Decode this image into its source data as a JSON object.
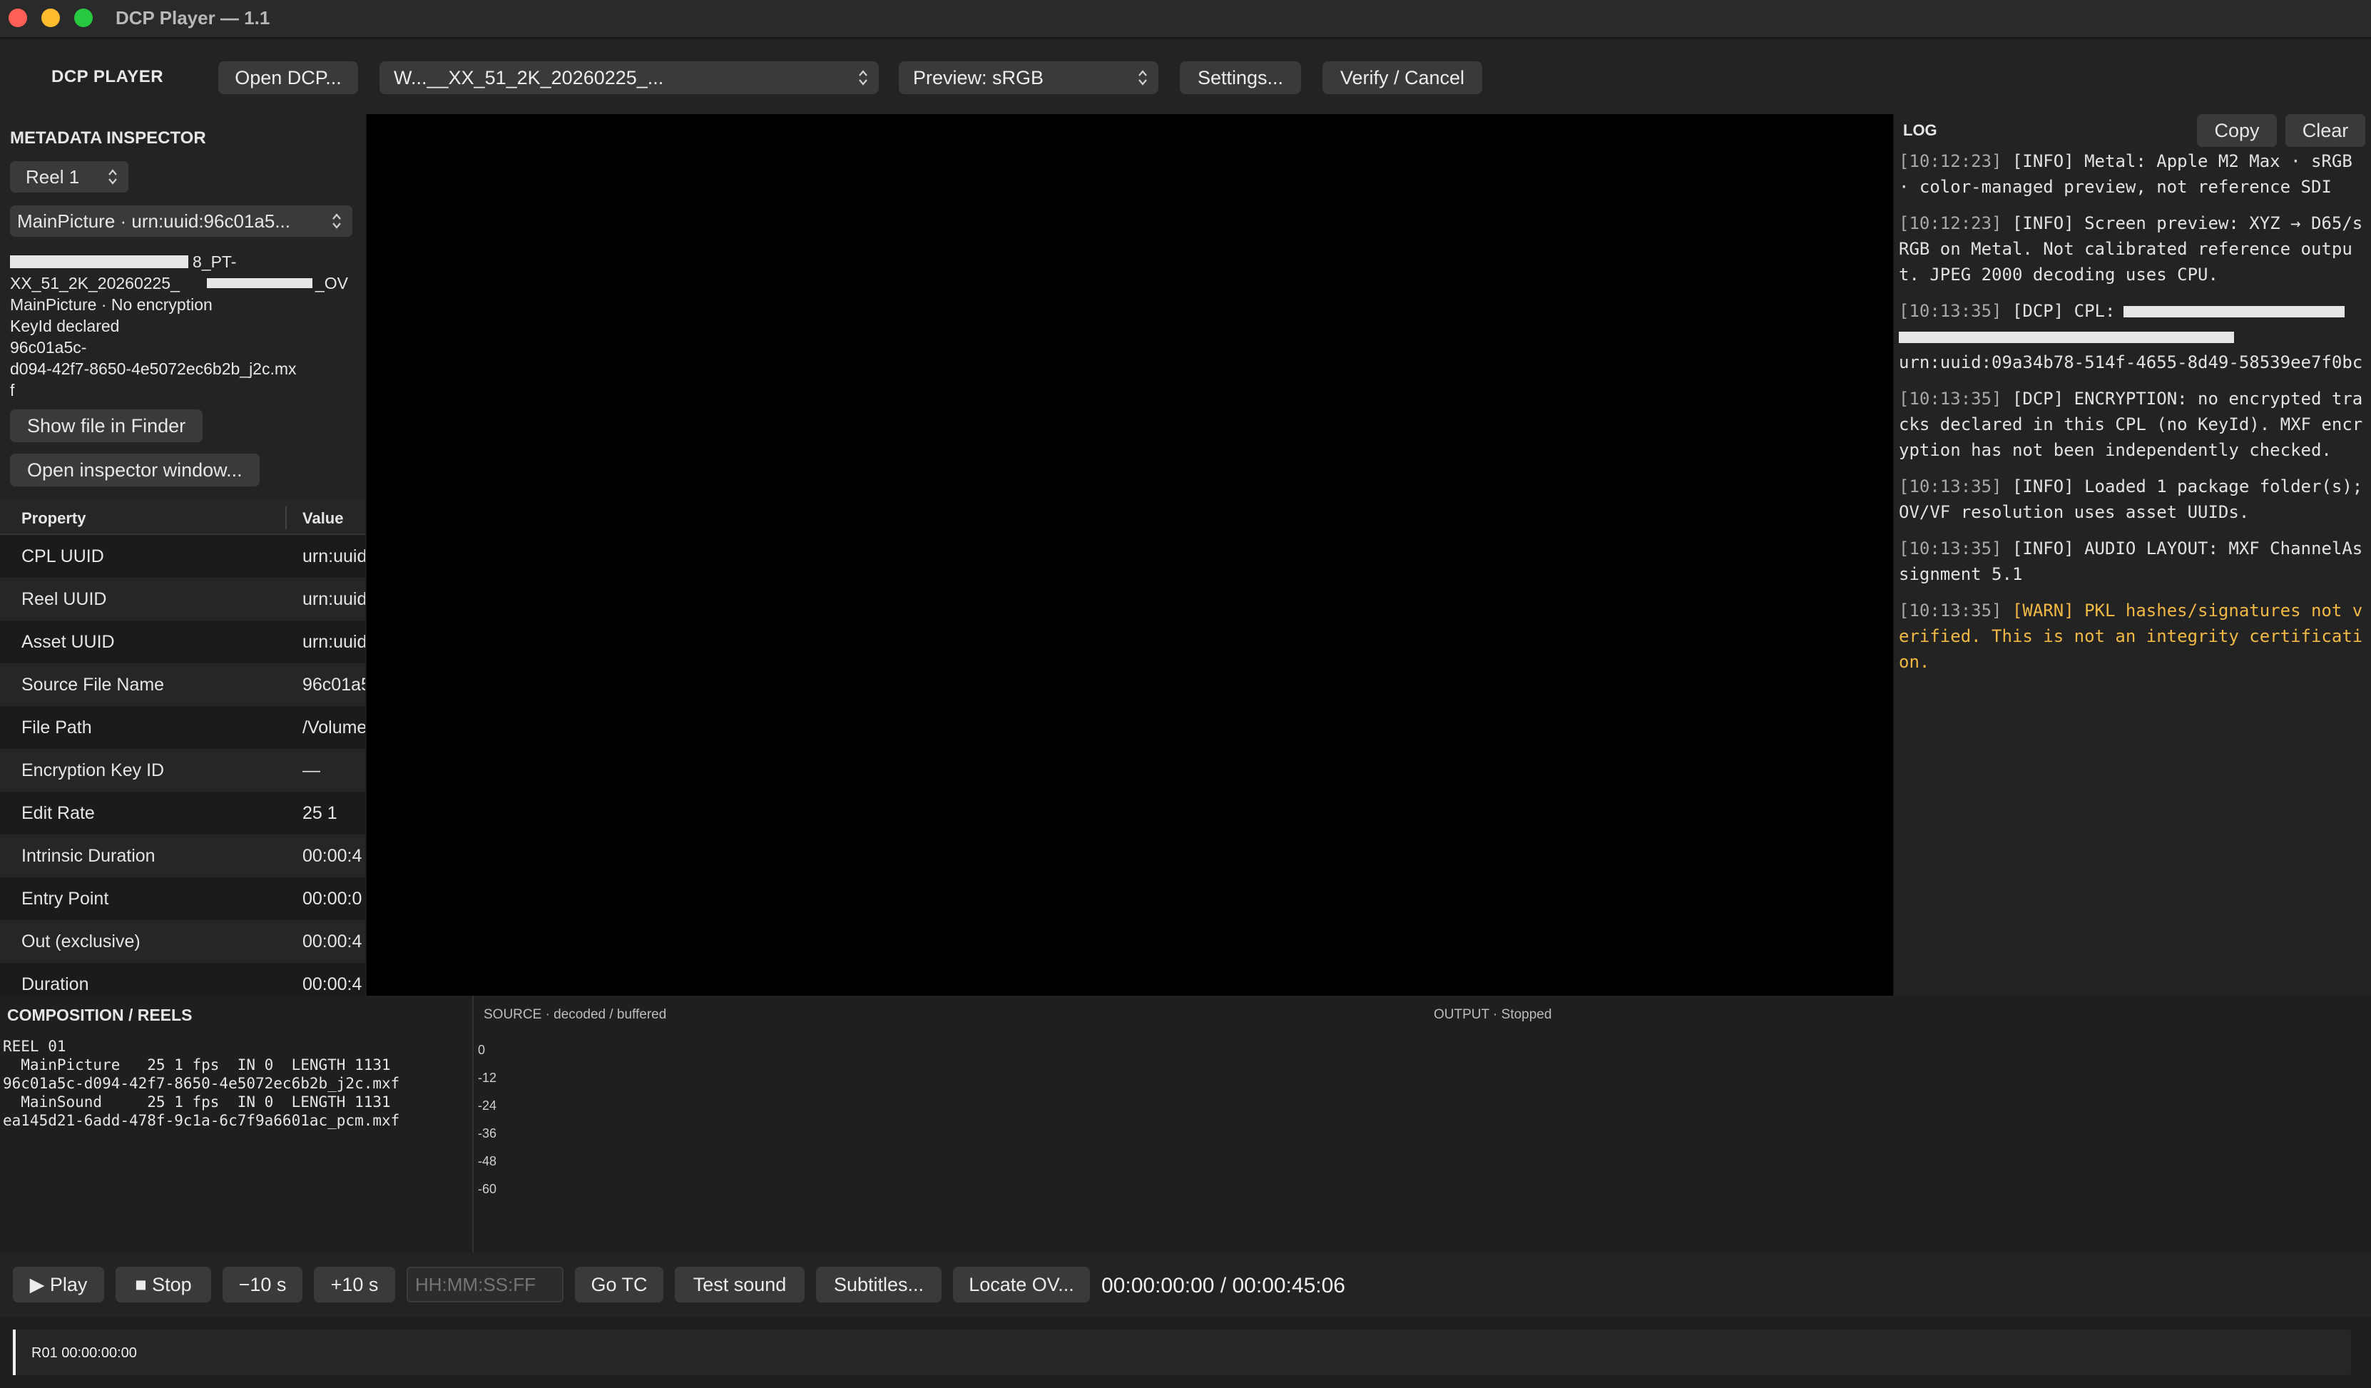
{
  "window": {
    "title": "DCP Player — 1.1"
  },
  "toolbar": {
    "brand": "DCP PLAYER",
    "open_dcp": "Open DCP...",
    "cpl_select": "W...__XX_51_2K_20260225_...",
    "preview_select": "Preview: sRGB",
    "settings": "Settings...",
    "verify_cancel": "Verify / Cancel"
  },
  "inspector": {
    "title": "METADATA INSPECTOR",
    "reel_select": "Reel 1",
    "asset_select": "MainPicture · urn:uuid:96c01a5...",
    "info_line1": "8_PT-",
    "info_line2": "XX_51_2K_20260225_",
    "info_line2_tail": "_OV",
    "info_line3": "MainPicture · No encryption",
    "info_line4": "KeyId declared",
    "info_line5": "96c01a5c-",
    "info_line6": "d094-42f7-8650-4e5072ec6b2b_j2c.mx",
    "info_line7": "f",
    "show_in_finder": "Show file in Finder",
    "open_inspector": "Open inspector window...",
    "table_headers": {
      "property": "Property",
      "value": "Value"
    },
    "rows": [
      {
        "k": "CPL UUID",
        "v": "urn:uuid"
      },
      {
        "k": "Reel UUID",
        "v": "urn:uuid"
      },
      {
        "k": "Asset UUID",
        "v": "urn:uuid"
      },
      {
        "k": "Source File Name",
        "v": "96c01a5"
      },
      {
        "k": "File Path",
        "v": "/Volume"
      },
      {
        "k": "Encryption Key ID",
        "v": "—"
      },
      {
        "k": "Edit Rate",
        "v": "25 1"
      },
      {
        "k": "Intrinsic Duration",
        "v": "00:00:4"
      },
      {
        "k": "Entry Point",
        "v": "00:00:0"
      },
      {
        "k": "Out (exclusive)",
        "v": "00:00:4"
      },
      {
        "k": "Duration",
        "v": "00:00:4"
      }
    ]
  },
  "log": {
    "title": "LOG",
    "copy": "Copy",
    "clear": "Clear",
    "entries": [
      {
        "ts": "[10:12:23]",
        "msg": " [INFO] Metal: Apple M2 Max · sRGB · color-managed preview, not reference SDI"
      },
      {
        "ts": "[10:12:23]",
        "msg": " [INFO] Screen preview: XYZ → D65/sRGB on Metal. Not calibrated reference output. JPEG 2000 decoding uses CPU."
      },
      {
        "ts": "[10:13:35]",
        "msg": " [DCP] CPL:",
        "msg2": "urn:uuid:09a34b78-514f-4655-8d49-58539ee7f0bc"
      },
      {
        "ts": "[10:13:35]",
        "msg": " [DCP] ENCRYPTION: no encrypted tracks declared in this CPL (no KeyId). MXF encryption has not been independently checked."
      },
      {
        "ts": "[10:13:35]",
        "msg": " [INFO] Loaded 1 package folder(s); OV/VF resolution uses asset UUIDs."
      },
      {
        "ts": "[10:13:35]",
        "msg": " [INFO] AUDIO LAYOUT: MXF ChannelAssignment 5.1"
      },
      {
        "ts": "[10:13:35]",
        "msg": " [WARN] PKL hashes/signatures not verified. This is not an integrity certification."
      }
    ]
  },
  "composition": {
    "title": "COMPOSITION / REELS",
    "text": "REEL 01\n  MainPicture   25 1 fps  IN 0  LENGTH 1131\n96c01a5c-d094-42f7-8650-4e5072ec6b2b_j2c.mxf\n  MainSound     25 1 fps  IN 0  LENGTH 1131\nea145d21-6add-478f-9c1a-6c7f9a6601ac_pcm.mxf"
  },
  "meters": {
    "source_label": "SOURCE · decoded / buffered",
    "output_label": "OUTPUT · Stopped",
    "db_ticks": [
      "0",
      "-12",
      "-24",
      "-36",
      "-48",
      "-60"
    ]
  },
  "transport": {
    "play": "▶ Play",
    "stop": "■ Stop",
    "back10": "−10 s",
    "fwd10": "+10 s",
    "tc_placeholder": "HH:MM:SS:FF",
    "go_tc": "Go TC",
    "test_sound": "Test sound",
    "subtitles": "Subtitles...",
    "locate_ov": "Locate OV...",
    "tc_readout": "00:00:00:00 / 00:00:45:06"
  },
  "timeline": {
    "reel_marker": "R01 00:00:00:00",
    "playhead_fraction": 0
  },
  "colors": {
    "warn": "#f0b845",
    "close": "#ff5f57",
    "minimize": "#febc2e",
    "maximize": "#28c840"
  }
}
